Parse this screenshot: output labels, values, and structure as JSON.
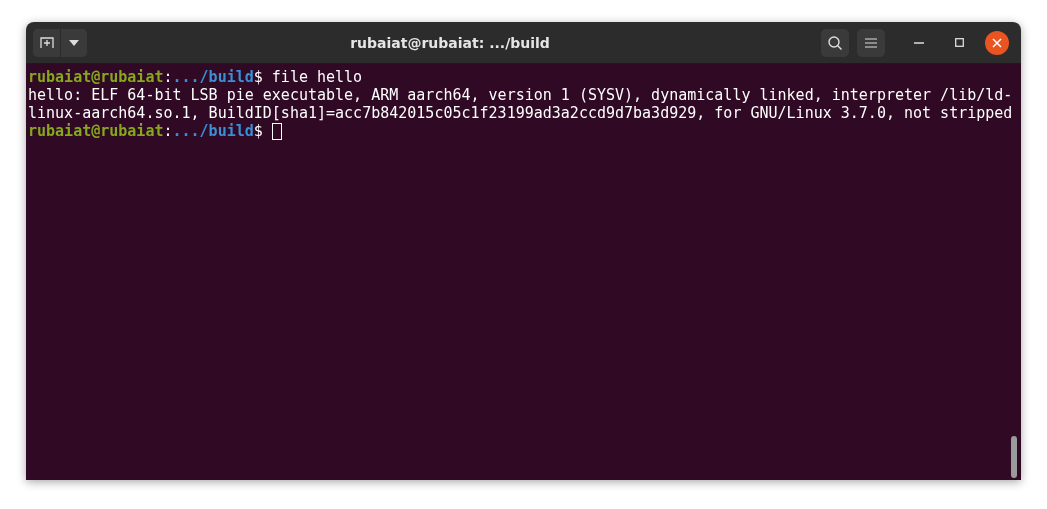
{
  "window": {
    "title": "rubaiat@rubaiat: .../build"
  },
  "lines": [
    {
      "kind": "prompt",
      "user": "rubaiat@rubaiat",
      "sep": ":",
      "path": ".../build",
      "symbol": "$",
      "command": " file hello"
    },
    {
      "kind": "output",
      "text": "hello: ELF 64-bit LSB pie executable, ARM aarch64, version 1 (SYSV), dynamically linked, interpreter /lib/ld-"
    },
    {
      "kind": "output",
      "text": "linux-aarch64.so.1, BuildID[sha1]=acc7b842015c05c1f23199ad3a2ccd9d7ba3d929, for GNU/Linux 3.7.0, not stripped"
    },
    {
      "kind": "prompt",
      "user": "rubaiat@rubaiat",
      "sep": ":",
      "path": ".../build",
      "symbol": "$",
      "cursor": true
    }
  ]
}
